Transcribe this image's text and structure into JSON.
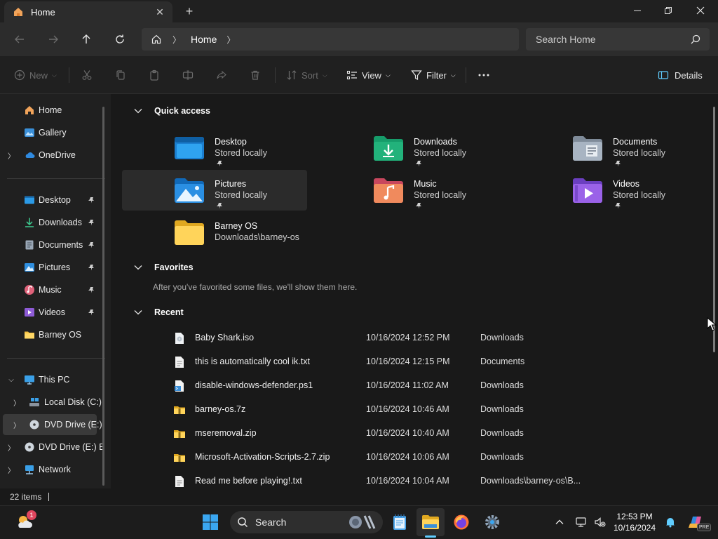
{
  "window": {
    "tab_title": "Home",
    "search_placeholder": "Search Home"
  },
  "address": {
    "crumbs": [
      "Home"
    ]
  },
  "commands": {
    "new": "New",
    "sort": "Sort",
    "view": "View",
    "filter": "Filter",
    "details": "Details"
  },
  "sidebar": {
    "top": [
      {
        "label": "Home",
        "icon": "home-icon"
      },
      {
        "label": "Gallery",
        "icon": "gallery-icon"
      },
      {
        "label": "OneDrive",
        "icon": "onedrive-icon"
      }
    ],
    "pinned": [
      {
        "label": "Desktop",
        "icon": "desktop-folder-icon"
      },
      {
        "label": "Downloads",
        "icon": "downloads-folder-icon"
      },
      {
        "label": "Documents",
        "icon": "documents-folder-icon"
      },
      {
        "label": "Pictures",
        "icon": "pictures-folder-icon"
      },
      {
        "label": "Music",
        "icon": "music-folder-icon"
      },
      {
        "label": "Videos",
        "icon": "videos-folder-icon"
      },
      {
        "label": "Barney OS",
        "icon": "folder-icon"
      }
    ],
    "pc": [
      {
        "label": "This PC",
        "icon": "pc-icon"
      },
      {
        "label": "Local Disk (C:)",
        "icon": "disk-icon"
      },
      {
        "label": "DVD Drive (E:)",
        "icon": "dvd-icon"
      },
      {
        "label": "DVD Drive (E:) B",
        "icon": "dvd-icon"
      },
      {
        "label": "Network",
        "icon": "network-icon"
      }
    ]
  },
  "quick_access": {
    "title": "Quick access",
    "tiles": [
      {
        "name": "Desktop",
        "sub": "Stored locally",
        "pinned": true,
        "icon": "desktop-folder-icon"
      },
      {
        "name": "Downloads",
        "sub": "Stored locally",
        "pinned": true,
        "icon": "downloads-folder-icon"
      },
      {
        "name": "Documents",
        "sub": "Stored locally",
        "pinned": true,
        "icon": "documents-folder-icon"
      },
      {
        "name": "Pictures",
        "sub": "Stored locally",
        "pinned": true,
        "icon": "pictures-folder-icon"
      },
      {
        "name": "Music",
        "sub": "Stored locally",
        "pinned": true,
        "icon": "music-folder-icon"
      },
      {
        "name": "Videos",
        "sub": "Stored locally",
        "pinned": true,
        "icon": "videos-folder-icon"
      },
      {
        "name": "Barney OS",
        "sub": "Downloads\\barney-os",
        "pinned": false,
        "icon": "folder-icon"
      }
    ]
  },
  "favorites": {
    "title": "Favorites",
    "empty_message": "After you've favorited some files, we'll show them here."
  },
  "recent": {
    "title": "Recent",
    "items": [
      {
        "name": "Baby Shark.iso",
        "date": "10/16/2024 12:52 PM",
        "location": "Downloads",
        "icon": "disc-image-file-icon"
      },
      {
        "name": "this is automatically cool ik.txt",
        "date": "10/16/2024 12:15 PM",
        "location": "Documents",
        "icon": "text-file-icon"
      },
      {
        "name": "disable-windows-defender.ps1",
        "date": "10/16/2024 11:02 AM",
        "location": "Downloads",
        "icon": "script-file-icon"
      },
      {
        "name": "barney-os.7z",
        "date": "10/16/2024 10:46 AM",
        "location": "Downloads",
        "icon": "archive-file-icon"
      },
      {
        "name": "mseremoval.zip",
        "date": "10/16/2024 10:40 AM",
        "location": "Downloads",
        "icon": "archive-file-icon"
      },
      {
        "name": "Microsoft-Activation-Scripts-2.7.zip",
        "date": "10/16/2024 10:06 AM",
        "location": "Downloads",
        "icon": "archive-file-icon"
      },
      {
        "name": "Read me before playing!.txt",
        "date": "10/16/2024 10:04 AM",
        "location": "Downloads\\barney-os\\B...",
        "icon": "text-file-icon"
      }
    ]
  },
  "status": {
    "item_count": "22 items"
  },
  "taskbar": {
    "search_label": "Search",
    "time": "12:53 PM",
    "date": "10/16/2024",
    "weather_badge": "1",
    "copilot_badge": "PRE"
  },
  "colors": {
    "accent": "#60cdff",
    "folder_yellow": "#f5c242",
    "window_bg": "#191919"
  }
}
